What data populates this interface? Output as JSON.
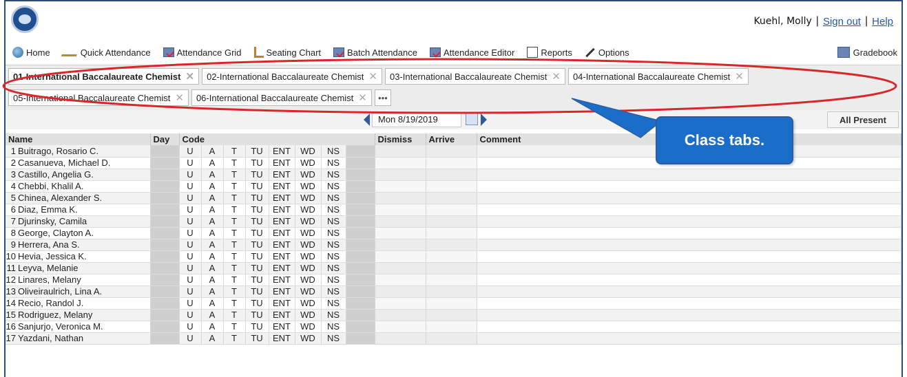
{
  "user": {
    "name": "Kuehl, Molly",
    "sign_out": "Sign out",
    "help": "Help"
  },
  "toolbar": {
    "items": [
      {
        "label": "Home",
        "icon": "home-icon"
      },
      {
        "label": "Quick Attendance",
        "icon": "quick-attendance-icon"
      },
      {
        "label": "Attendance Grid",
        "icon": "attendance-grid-icon"
      },
      {
        "label": "Seating Chart",
        "icon": "seating-chart-icon"
      },
      {
        "label": "Batch Attendance",
        "icon": "batch-attendance-icon"
      },
      {
        "label": "Attendance Editor",
        "icon": "attendance-editor-icon"
      },
      {
        "label": "Reports",
        "icon": "reports-icon"
      },
      {
        "label": "Options",
        "icon": "options-icon"
      }
    ],
    "gradebook": "Gradebook"
  },
  "tabs": [
    "01-International Baccalaureate Chemist",
    "02-International Baccalaureate Chemist",
    "03-International Baccalaureate Chemist",
    "04-International Baccalaureate Chemist",
    "05-International Baccalaureate Chemist",
    "06-International Baccalaureate Chemist"
  ],
  "active_tab_index": 0,
  "tab_more_label": "•••",
  "date": {
    "value": "Mon 8/19/2019"
  },
  "all_present": "All Present",
  "columns": {
    "name": "Name",
    "day": "Day",
    "code": "Code",
    "dismiss": "Dismiss",
    "arrive": "Arrive",
    "comment": "Comment"
  },
  "codes": [
    "U",
    "A",
    "T",
    "TU",
    "ENT",
    "WD",
    "NS"
  ],
  "students": [
    "Buitrago, Rosario C.",
    "Casanueva, Michael D.",
    "Castillo, Angelia G.",
    "Chebbi, Khalil A.",
    "Chinea, Alexander S.",
    "Diaz, Emma K.",
    "Djurinsky, Camila",
    "George, Clayton A.",
    "Herrera, Ana S.",
    "Hevia, Jessica K.",
    "Leyva, Melanie",
    "Linares, Melany",
    "Oliveiraulrich, Lina A.",
    "Recio, Randol J.",
    "Rodriguez, Melany",
    "Sanjurjo, Veronica M.",
    "Yazdani, Nathan"
  ],
  "callout": "Class tabs.",
  "colors": {
    "annotation_red": "#d9262b",
    "callout_blue": "#1a6ec9",
    "frame_navy": "#2a4a7a"
  }
}
